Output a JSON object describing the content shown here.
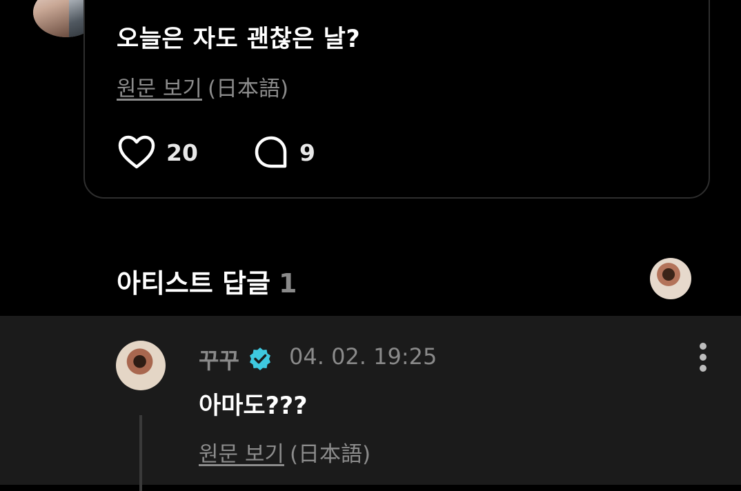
{
  "post": {
    "text": "오늘은 자도 괜찮은 날?",
    "view_original": "원문 보기",
    "original_language": "(日本語)",
    "likes": "20",
    "comments": "9"
  },
  "artist_replies": {
    "title": "아티스트 답글",
    "count": "1"
  },
  "reply": {
    "author": "꾸꾸",
    "timestamp": "04. 02. 19:25",
    "text": "아마도???",
    "view_original": "원문 보기",
    "original_language": "(日本語)"
  },
  "colors": {
    "background": "#000000",
    "reply_background": "#1b1b1b",
    "muted_text": "#8a8a8a",
    "verified_badge": "#3ec9e0"
  },
  "icons": [
    "heart-icon",
    "comment-bubble-icon",
    "verified-badge-icon",
    "more-vertical-icon"
  ]
}
